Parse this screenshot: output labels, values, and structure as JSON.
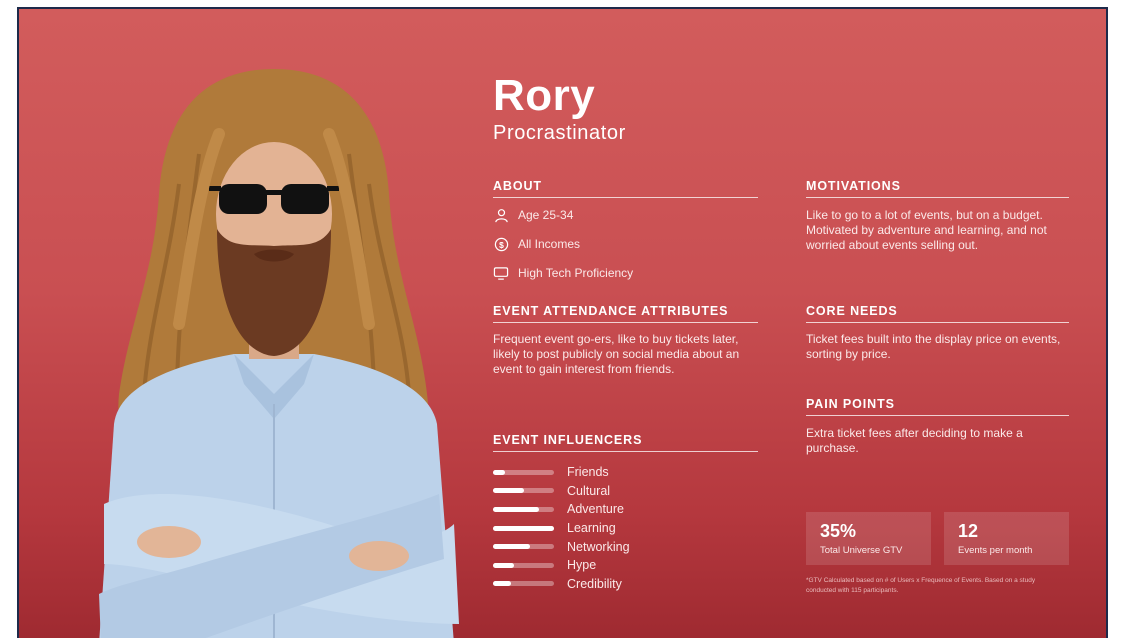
{
  "persona": {
    "name": "Rory",
    "role": "Procrastinator"
  },
  "about": {
    "heading": "ABOUT",
    "items": [
      {
        "icon": "person-icon",
        "text": "Age 25-34"
      },
      {
        "icon": "dollar-circle-icon",
        "text": "All Incomes"
      },
      {
        "icon": "monitor-icon",
        "text": "High Tech Proficiency"
      }
    ]
  },
  "attendance": {
    "heading": "EVENT ATTENDANCE ATTRIBUTES",
    "text": "Frequent event go-ers, like to buy tickets later, likely to post publicly on social media about an event to gain interest from friends."
  },
  "influencers": {
    "heading": "EVENT INFLUENCERS",
    "items": [
      {
        "label": "Friends",
        "level": 0.2
      },
      {
        "label": "Cultural",
        "level": 0.5
      },
      {
        "label": "Adventure",
        "level": 0.75
      },
      {
        "label": "Learning",
        "level": 1.0
      },
      {
        "label": "Networking",
        "level": 0.6
      },
      {
        "label": "Hype",
        "level": 0.35
      },
      {
        "label": "Credibility",
        "level": 0.3
      }
    ]
  },
  "motivations": {
    "heading": "MOTIVATIONS",
    "text": "Like to go to a lot of events, but on a budget. Motivated by adventure and learning, and not worried about events selling out."
  },
  "core_needs": {
    "heading": "CORE NEEDS",
    "text": "Ticket fees built into the display price on events, sorting by price."
  },
  "pain_points": {
    "heading": "PAIN POINTS",
    "text": "Extra ticket fees after deciding to make a purchase."
  },
  "stats": [
    {
      "value": "35%",
      "label": "Total Universe GTV"
    },
    {
      "value": "12",
      "label": "Events per month"
    }
  ],
  "footnote": "*GTV Calculated based on # of Users x Frequence of Events. Based on a study conducted with 115 participants.",
  "colors": {
    "background": "#c94f52",
    "accent": "#ffffff",
    "border": "#1e2a4a"
  }
}
